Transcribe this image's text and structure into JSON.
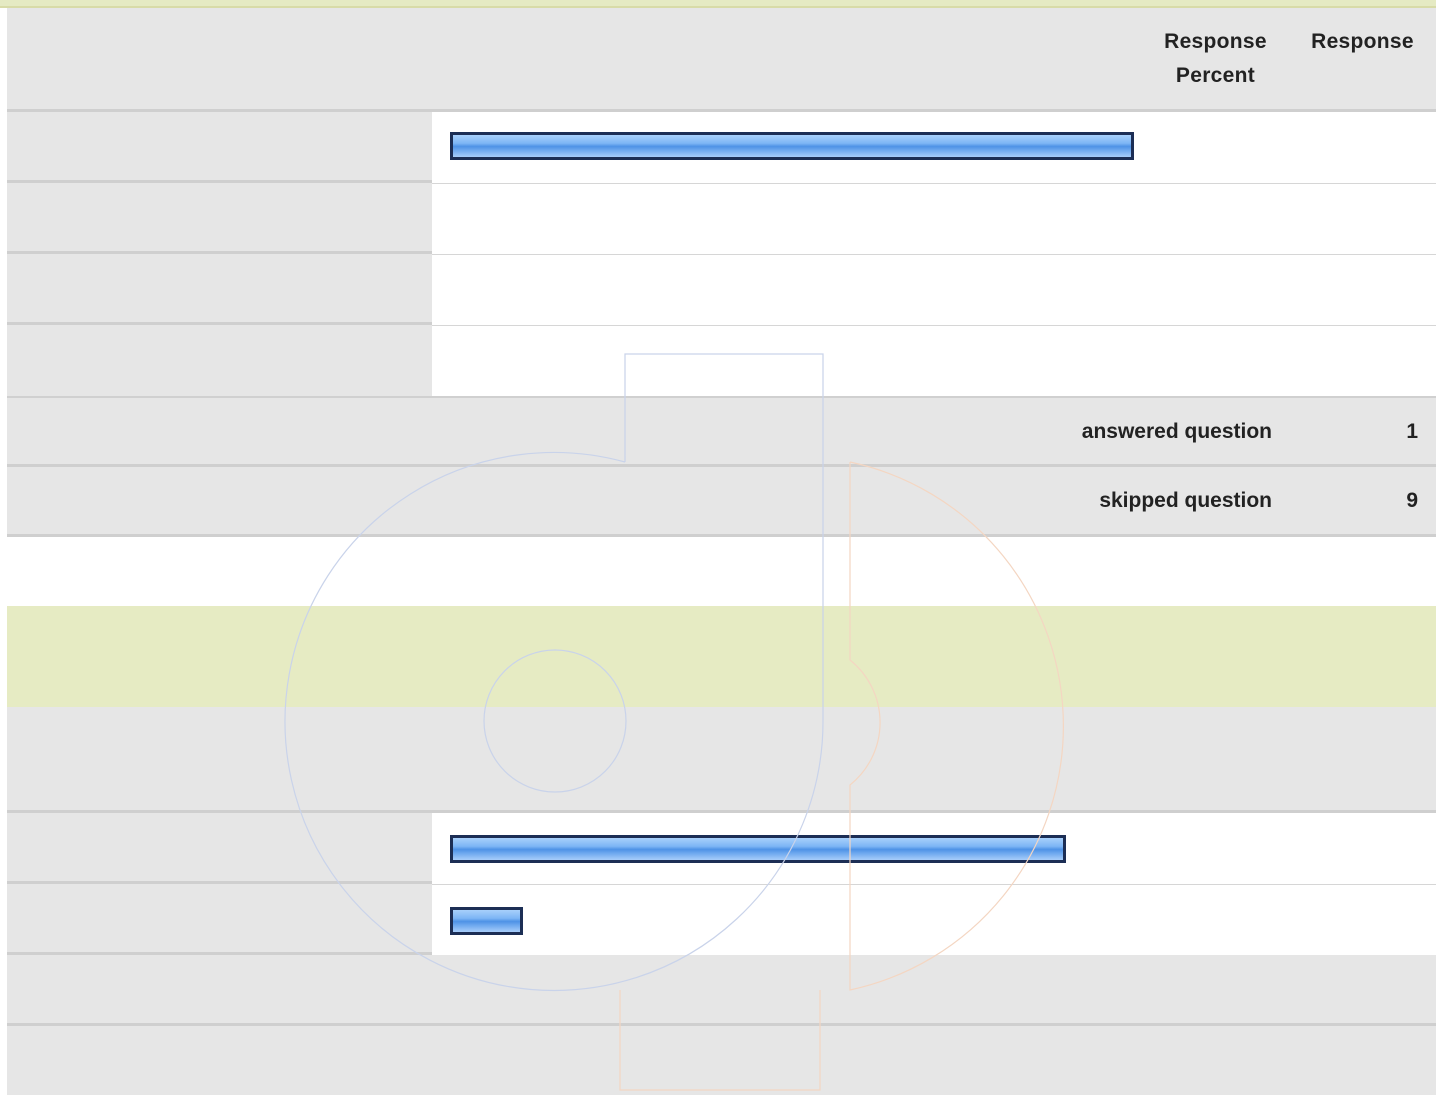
{
  "table1": {
    "header": {
      "percent_label": "Response Percent",
      "count_label": "Response"
    },
    "rows": [
      {
        "percent": 1.0
      },
      {
        "percent": 0
      },
      {
        "percent": 0
      },
      {
        "percent": 0
      }
    ],
    "summary": {
      "answered_label": "answered question",
      "answered_count": "1",
      "skipped_label": "skipped question",
      "skipped_count": "9"
    }
  },
  "table2": {
    "rows": [
      {
        "percent": 0.9
      },
      {
        "percent": 0.1
      },
      {
        "percent": 0
      },
      {
        "percent": 0
      }
    ]
  },
  "colors": {
    "green_band": "#e6ebc3",
    "row_gray": "#e6e6e6",
    "bar_border": "#1c2e55",
    "bar_fill": "#7db5f5"
  },
  "watermark": {
    "icon": "logo-watermark-icon"
  }
}
